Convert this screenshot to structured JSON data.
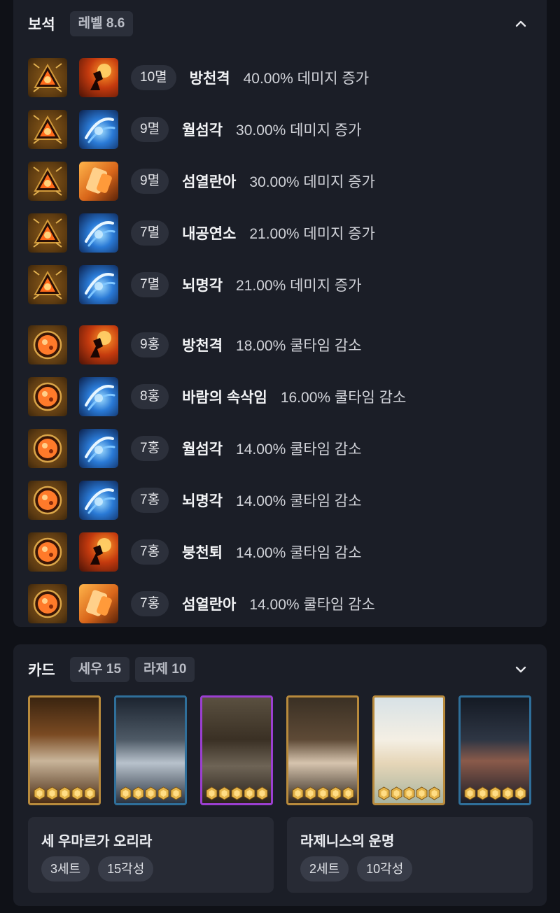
{
  "gems": {
    "title": "보석",
    "level_chip": "레벨 8.6",
    "toggle_icon": "chevron-up-icon",
    "rows": [
      {
        "gem_type": "멸",
        "gem_color": "red",
        "skill_icon": "fire-strike-skill-icon",
        "level": "10멸",
        "skill": "방천격",
        "effect": "40.00% 데미지 증가"
      },
      {
        "gem_type": "멸",
        "gem_color": "red",
        "skill_icon": "blue-crescent-skill-icon",
        "level": "9멸",
        "skill": "월섬각",
        "effect": "30.00% 데미지 증가"
      },
      {
        "gem_type": "멸",
        "gem_color": "red",
        "skill_icon": "orange-fist-skill-icon",
        "level": "9멸",
        "skill": "섬열란아",
        "effect": "30.00% 데미지 증가"
      },
      {
        "gem_type": "멸",
        "gem_color": "red",
        "skill_icon": "blue-vortex-skill-icon",
        "level": "7멸",
        "skill": "내공연소",
        "effect": "21.00% 데미지 증가"
      },
      {
        "gem_type": "멸",
        "gem_color": "red",
        "skill_icon": "blue-lightning-skill-icon",
        "level": "7멸",
        "skill": "뇌명각",
        "effect": "21.00% 데미지 증가"
      },
      {
        "gem_type": "홍",
        "gem_color": "orange",
        "skill_icon": "fire-strike-skill-icon",
        "level": "9홍",
        "skill": "방천격",
        "effect": "18.00% 쿨타임 감소"
      },
      {
        "gem_type": "홍",
        "gem_color": "orange",
        "skill_icon": "blue-runner-skill-icon",
        "level": "8홍",
        "skill": "바람의 속삭임",
        "effect": "16.00% 쿨타임 감소"
      },
      {
        "gem_type": "홍",
        "gem_color": "orange",
        "skill_icon": "blue-crescent-skill-icon",
        "level": "7홍",
        "skill": "월섬각",
        "effect": "14.00% 쿨타임 감소"
      },
      {
        "gem_type": "홍",
        "gem_color": "orange",
        "skill_icon": "blue-lightning-skill-icon",
        "level": "7홍",
        "skill": "뇌명각",
        "effect": "14.00% 쿨타임 감소"
      },
      {
        "gem_type": "홍",
        "gem_color": "orange",
        "skill_icon": "fire-kick-skill-icon",
        "level": "7홍",
        "skill": "붕천퇴",
        "effect": "14.00% 쿨타임 감소"
      },
      {
        "gem_type": "홍",
        "gem_color": "orange",
        "skill_icon": "orange-fist-skill-icon",
        "level": "7홍",
        "skill": "섬열란아",
        "effect": "14.00% 쿨타임 감소"
      }
    ]
  },
  "cards": {
    "title": "카드",
    "chips": [
      "세우 15",
      "라제 10"
    ],
    "toggle_icon": "chevron-down-icon",
    "items": [
      {
        "frame": "gold",
        "portrait": "bearded-dwarf-card-art",
        "awakening_stars": 5
      },
      {
        "frame": "blue",
        "portrait": "armored-dwarf-card-art",
        "awakening_stars": 5
      },
      {
        "frame": "purple",
        "portrait": "hatted-wizard-card-art",
        "awakening_stars": 5
      },
      {
        "frame": "gold",
        "portrait": "dark-haired-woman-card-art",
        "awakening_stars": 5
      },
      {
        "frame": "gold",
        "portrait": "winged-angel-card-art",
        "awakening_stars": 5
      },
      {
        "frame": "blue",
        "portrait": "dark-knight-card-art",
        "awakening_stars": 5
      }
    ],
    "sets": [
      {
        "name": "세 우마르가 오리라",
        "tags": [
          "3세트",
          "15각성"
        ]
      },
      {
        "name": "라제니스의 운명",
        "tags": [
          "2세트",
          "10각성"
        ]
      }
    ]
  },
  "colors": {
    "page_bg": "#0f1117",
    "panel_bg": "#1b1e27",
    "chip_bg": "#2b2f3a",
    "badge_bg": "#2c303b",
    "set_box_bg": "#272a34",
    "card_gold_frame": "#b88a3c",
    "card_blue_frame": "#2f6f9a",
    "card_purple_frame": "#9b3fd1"
  }
}
